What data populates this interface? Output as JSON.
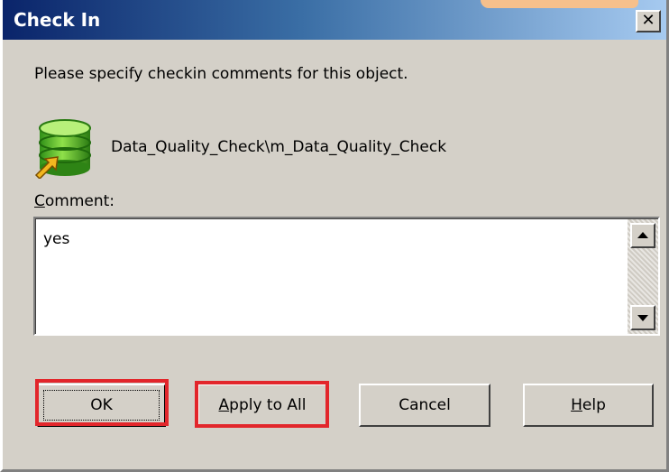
{
  "window": {
    "title": "Check In",
    "close_glyph": "✕"
  },
  "instruction": "Please specify checkin comments for this object.",
  "object": {
    "icon": "database-checkin-icon",
    "path": "Data_Quality_Check\\m_Data_Quality_Check"
  },
  "comment": {
    "label_accel": "C",
    "label_rest": "omment:",
    "value": "yes"
  },
  "buttons": {
    "ok": "OK",
    "apply_accel": "A",
    "apply_rest": "pply to All",
    "cancel": "Cancel",
    "help_accel": "H",
    "help_rest": "elp"
  },
  "colors": {
    "highlight": "#e2262b",
    "titlebar_start": "#0a246a",
    "titlebar_end": "#a6caf0",
    "dialog_bg": "#d4d0c8"
  }
}
